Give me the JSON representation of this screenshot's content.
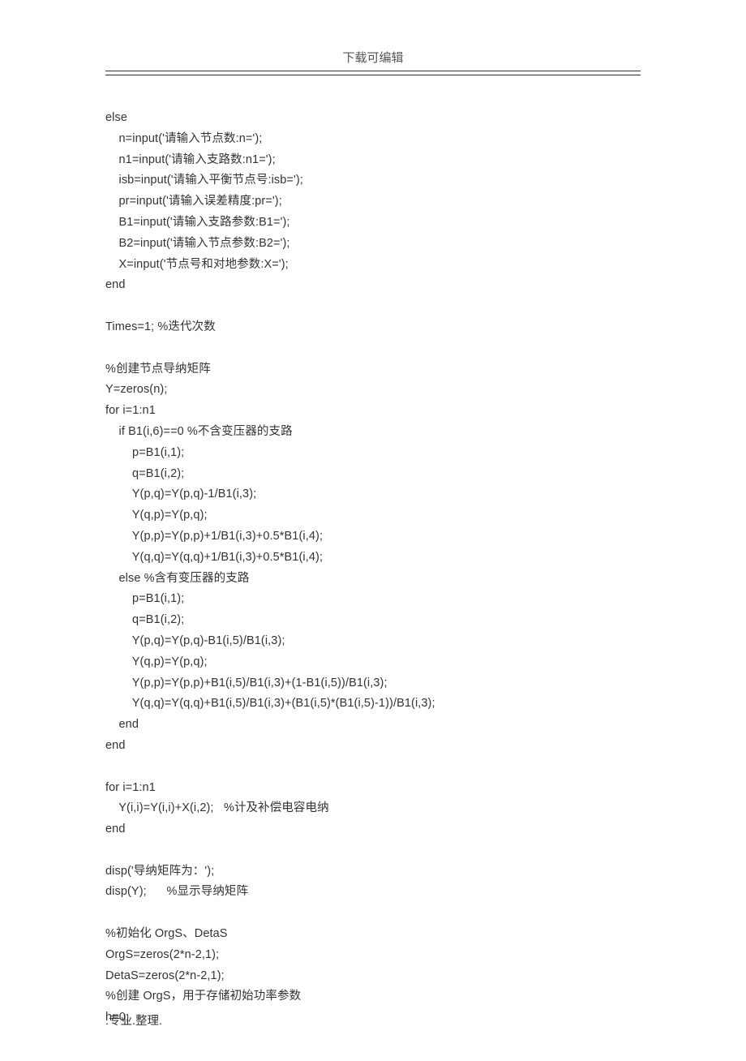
{
  "header": "下载可编辑",
  "footer": ".专业.整理.",
  "lines": [
    "else",
    "    n=input('请输入节点数:n=');",
    "    n1=input('请输入支路数:n1=');",
    "    isb=input('请输入平衡节点号:isb=');",
    "    pr=input('请输入误差精度:pr=');",
    "    B1=input('请输入支路参数:B1=');",
    "    B2=input('请输入节点参数:B2=');",
    "    X=input('节点号和对地参数:X=');",
    "end",
    "",
    "Times=1; %迭代次数",
    "",
    "%创建节点导纳矩阵",
    "Y=zeros(n);",
    "for i=1:n1",
    "    if B1(i,6)==0 %不含变压器的支路",
    "        p=B1(i,1);",
    "        q=B1(i,2);",
    "        Y(p,q)=Y(p,q)-1/B1(i,3);",
    "        Y(q,p)=Y(p,q);",
    "        Y(p,p)=Y(p,p)+1/B1(i,3)+0.5*B1(i,4);",
    "        Y(q,q)=Y(q,q)+1/B1(i,3)+0.5*B1(i,4);",
    "    else %含有变压器的支路",
    "        p=B1(i,1);",
    "        q=B1(i,2);",
    "        Y(p,q)=Y(p,q)-B1(i,5)/B1(i,3);",
    "        Y(q,p)=Y(p,q);",
    "        Y(p,p)=Y(p,p)+B1(i,5)/B1(i,3)+(1-B1(i,5))/B1(i,3);",
    "        Y(q,q)=Y(q,q)+B1(i,5)/B1(i,3)+(B1(i,5)*(B1(i,5)-1))/B1(i,3);",
    "    end",
    "end",
    "",
    "for i=1:n1",
    "    Y(i,i)=Y(i,i)+X(i,2);   %计及补偿电容电纳",
    "end",
    "",
    "disp('导纳矩阵为：');",
    "disp(Y);      %显示导纳矩阵",
    "",
    "%初始化 OrgS、DetaS",
    "OrgS=zeros(2*n-2,1);",
    "DetaS=zeros(2*n-2,1);",
    "%创建 OrgS，用于存储初始功率参数",
    "h=0;"
  ]
}
